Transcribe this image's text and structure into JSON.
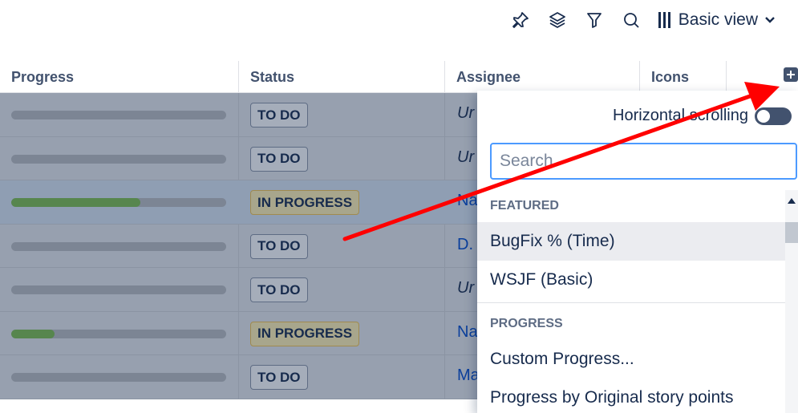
{
  "toolbar": {
    "icons": [
      "pin-icon",
      "layers-icon",
      "filter-icon",
      "search-icon"
    ],
    "view_label": "Basic view"
  },
  "table": {
    "columns": [
      "Progress",
      "Status",
      "Assignee",
      "Icons"
    ],
    "rows": [
      {
        "progress": 0.0,
        "status": "TO DO",
        "assignee": "Ur",
        "assignee_style": "italic"
      },
      {
        "progress": 0.0,
        "status": "TO DO",
        "assignee": "Ur",
        "assignee_style": "italic"
      },
      {
        "progress": 0.6,
        "status": "IN PROGRESS",
        "assignee": "Na",
        "assignee_style": "link"
      },
      {
        "progress": 0.0,
        "status": "TO DO",
        "assignee": "D.",
        "assignee_style": "link"
      },
      {
        "progress": 0.0,
        "status": "TO DO",
        "assignee": "Ur",
        "assignee_style": "italic"
      },
      {
        "progress": 0.2,
        "status": "IN PROGRESS",
        "assignee": "Na",
        "assignee_style": "link"
      },
      {
        "progress": 0.0,
        "status": "TO DO",
        "assignee": "Ma",
        "assignee_style": "link"
      }
    ]
  },
  "panel": {
    "horizontal_scrolling_label": "Horizontal scrolling",
    "horizontal_scrolling_on": false,
    "search_placeholder": "Search",
    "groups": [
      {
        "title": "FEATURED",
        "items": [
          "BugFix % (Time)",
          "WSJF (Basic)"
        ]
      },
      {
        "title": "PROGRESS",
        "items": [
          "Custom Progress...",
          "Progress by Original story points"
        ]
      }
    ]
  },
  "colors": {
    "accent": "#4c9aff",
    "progress_fill": "#57864e",
    "arrow": "#ff0000"
  }
}
